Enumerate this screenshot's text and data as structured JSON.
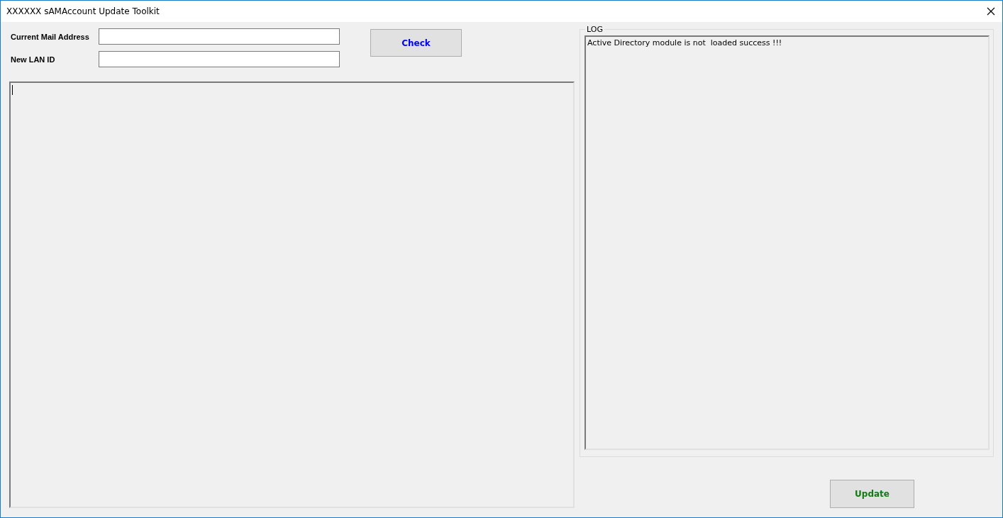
{
  "window": {
    "title": "XXXXXX sAMAccount Update Toolkit"
  },
  "form": {
    "fields": [
      {
        "label": "Current Mail Address"
      },
      {
        "label": "New LAN ID"
      }
    ],
    "check_button": "Check"
  },
  "output": {
    "focused": true
  },
  "log": {
    "title": "LOG",
    "lines": [
      "Active Directory module is not  loaded success !!!"
    ]
  },
  "update_button": "Update"
}
